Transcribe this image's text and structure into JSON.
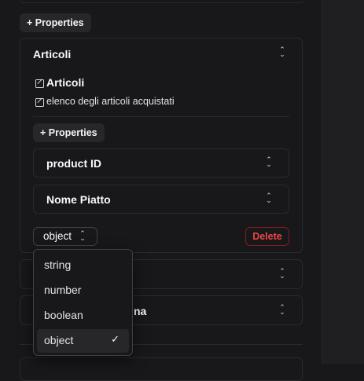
{
  "toolbar": {
    "add_properties_label": "+ Properties"
  },
  "articoli_section": {
    "header_title": "Articoli",
    "name_value": "Articoli",
    "description_value": "elenco degli articoli acquistati",
    "add_properties_label": "+ Properties",
    "children": [
      {
        "label": "product ID"
      },
      {
        "label": "Nome Piatto"
      }
    ],
    "type_select_value": "object",
    "delete_label": "Delete"
  },
  "type_dropdown": {
    "options": [
      {
        "label": "string",
        "selected": false
      },
      {
        "label": "number",
        "selected": false
      },
      {
        "label": "boolean",
        "selected": false
      },
      {
        "label": "object",
        "selected": true
      }
    ],
    "check_glyph": "✓"
  },
  "background_cards": {
    "partial_title_suffix": "na"
  },
  "icons": {
    "expand": "chevron-up-down-icon",
    "edit": "edit-icon",
    "check": "check-icon"
  },
  "colors": {
    "background": "#18181b",
    "border": "#2a2a2e",
    "chip": "#27272a",
    "danger": "#ef4444"
  }
}
